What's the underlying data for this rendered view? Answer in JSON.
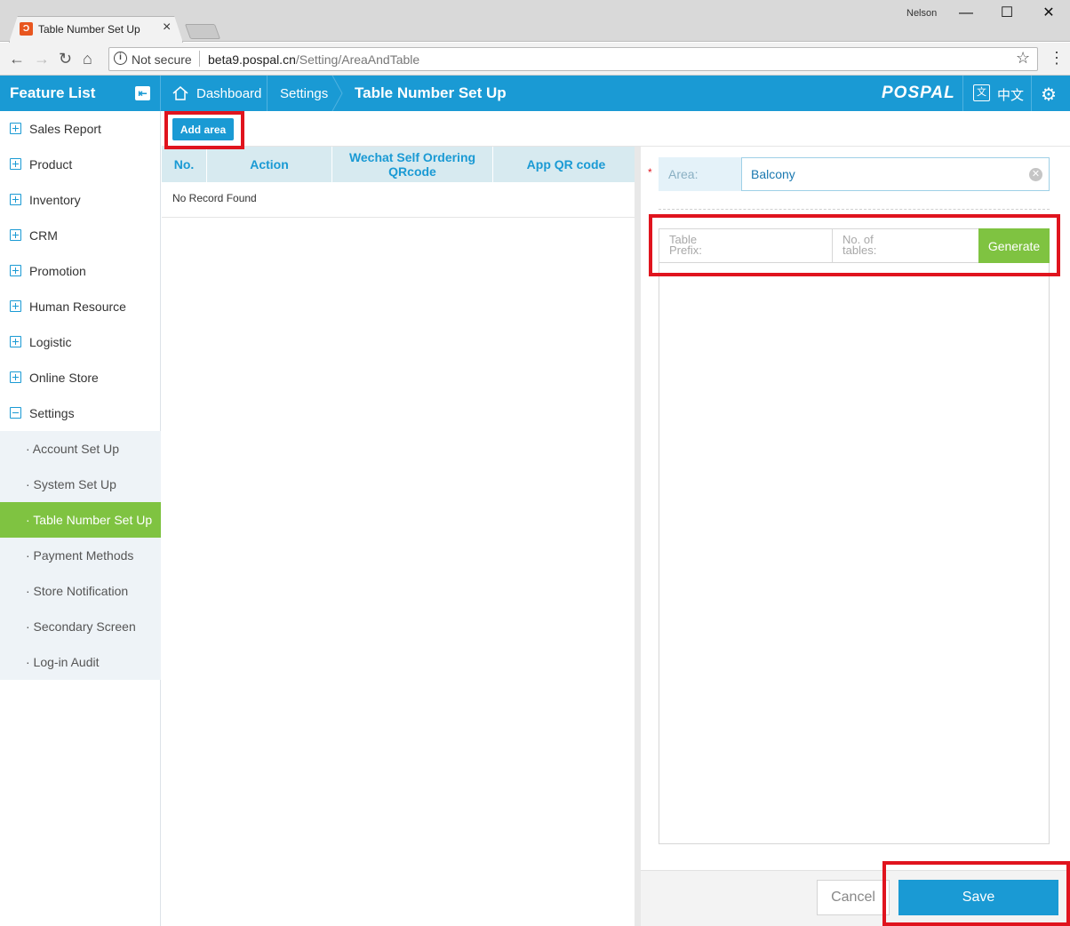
{
  "browser": {
    "tab_title": "Table Number Set Up",
    "user": "Nelson",
    "not_secure": "Not secure",
    "url_host": "beta9.pospal.cn",
    "url_path": "/Setting/AreaAndTable"
  },
  "header": {
    "feature_list": "Feature List",
    "breadcrumb": [
      "Dashboard",
      "Settings"
    ],
    "current": "Table Number Set Up",
    "logo": "POSPAL",
    "language": "中文"
  },
  "sidebar": {
    "items": [
      "Sales Report",
      "Product",
      "Inventory",
      "CRM",
      "Promotion",
      "Human Resource",
      "Logistic",
      "Online Store",
      "Settings"
    ],
    "sub_items": [
      "· Account Set Up",
      "· System Set Up",
      "· Table Number Set Up",
      "· Payment Methods",
      "· Store Notification",
      "· Secondary Screen",
      "· Log-in Audit"
    ],
    "active_sub": 2
  },
  "main": {
    "add_area": "Add area",
    "columns": [
      "No.",
      "Action",
      "Wechat Self Ordering QRcode",
      "App QR code"
    ],
    "empty": "No Record Found"
  },
  "form": {
    "required_mark": "*",
    "area_label": "Area:",
    "area_value": "Balcony",
    "prefix_placeholder_1": "Table",
    "prefix_placeholder_2": "Prefix:",
    "count_placeholder_1": "No. of",
    "count_placeholder_2": "tables:",
    "generate": "Generate",
    "cancel": "Cancel",
    "save": "Save"
  },
  "colors": {
    "primary": "#1a9ad4",
    "active_green": "#7fc341",
    "highlight_red": "#e0141e"
  }
}
